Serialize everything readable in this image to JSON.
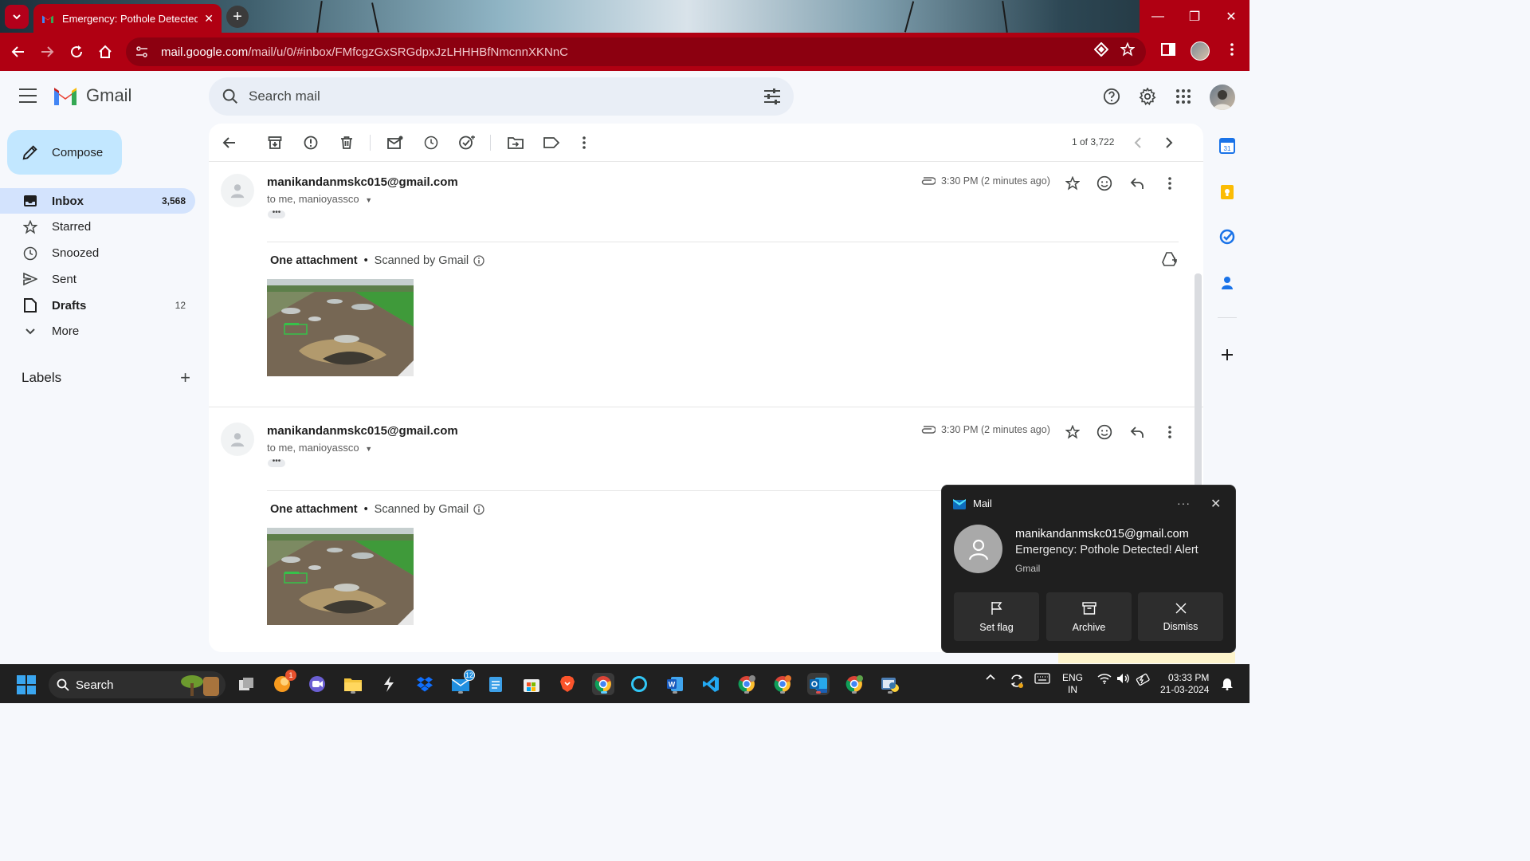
{
  "browser": {
    "tab_title": "Emergency: Pothole Detected! A",
    "url_host": "mail.google.com",
    "url_path": "/mail/u/0/#inbox/FMfcgzGxSRGdpxJzLHHHBfNmcnnXKNnC",
    "accent_color": "#b00012"
  },
  "gmail": {
    "app_name": "Gmail",
    "search_placeholder": "Search mail",
    "compose_label": "Compose",
    "nav": [
      {
        "label": "Inbox",
        "count": "3,568",
        "icon": "inbox-icon"
      },
      {
        "label": "Starred",
        "count": "",
        "icon": "star-icon"
      },
      {
        "label": "Snoozed",
        "count": "",
        "icon": "clock-icon"
      },
      {
        "label": "Sent",
        "count": "",
        "icon": "send-icon"
      },
      {
        "label": "Drafts",
        "count": "12",
        "icon": "draft-icon"
      },
      {
        "label": "More",
        "count": "",
        "icon": "chevron-down-icon"
      }
    ],
    "labels_heading": "Labels",
    "pager": "1 of 3,722",
    "messages": [
      {
        "from": "manikandanmskc015@gmail.com",
        "to": "to me, manioyassco",
        "time": "3:30 PM (2 minutes ago)",
        "attachment_label": "One attachment",
        "scan_label": "Scanned by Gmail"
      },
      {
        "from": "manikandanmskc015@gmail.com",
        "to": "to me, manioyassco",
        "time": "3:30 PM (2 minutes ago)",
        "attachment_label": "One attachment",
        "scan_label": "Scanned by Gmail"
      }
    ]
  },
  "notification": {
    "app": "Mail",
    "sender": "manikandanmskc015@gmail.com",
    "subject": "Emergency: Pothole Detected! Alert",
    "source": "Gmail",
    "actions": [
      {
        "label": "Set flag",
        "icon": "flag-icon"
      },
      {
        "label": "Archive",
        "icon": "archive-icon"
      },
      {
        "label": "Dismiss",
        "icon": "close-icon"
      }
    ]
  },
  "taskbar": {
    "search_label": "Search",
    "lang_line1": "ENG",
    "lang_line2": "IN",
    "time": "03:33 PM",
    "date": "21-03-2024",
    "badges": {
      "app1": "1",
      "mail": "12"
    }
  }
}
